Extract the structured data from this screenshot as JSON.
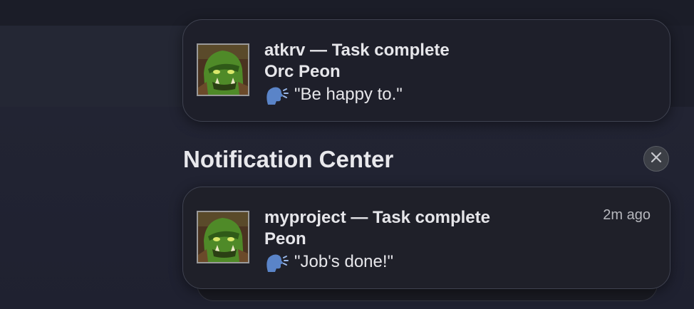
{
  "notifications": [
    {
      "title": "atkrv — Task complete",
      "subtitle": "Orc Peon",
      "message": "\"Be happy to.\"",
      "icon": "orc-peon-avatar",
      "speak_icon": "speaking-head-icon",
      "timestamp": ""
    },
    {
      "title": "myproject — Task complete",
      "subtitle": "Peon",
      "message": "\"Job's done!\"",
      "icon": "orc-peon-avatar",
      "speak_icon": "speaking-head-icon",
      "timestamp": "2m ago"
    }
  ],
  "notification_center": {
    "header": "Notification Center",
    "close_icon": "close-icon"
  },
  "colors": {
    "background": "#1d1f2b",
    "card": "#1f2029",
    "text": "#e6e6ea",
    "muted_text": "#b6b7bd",
    "orc_skin": "#5c9a2e"
  }
}
